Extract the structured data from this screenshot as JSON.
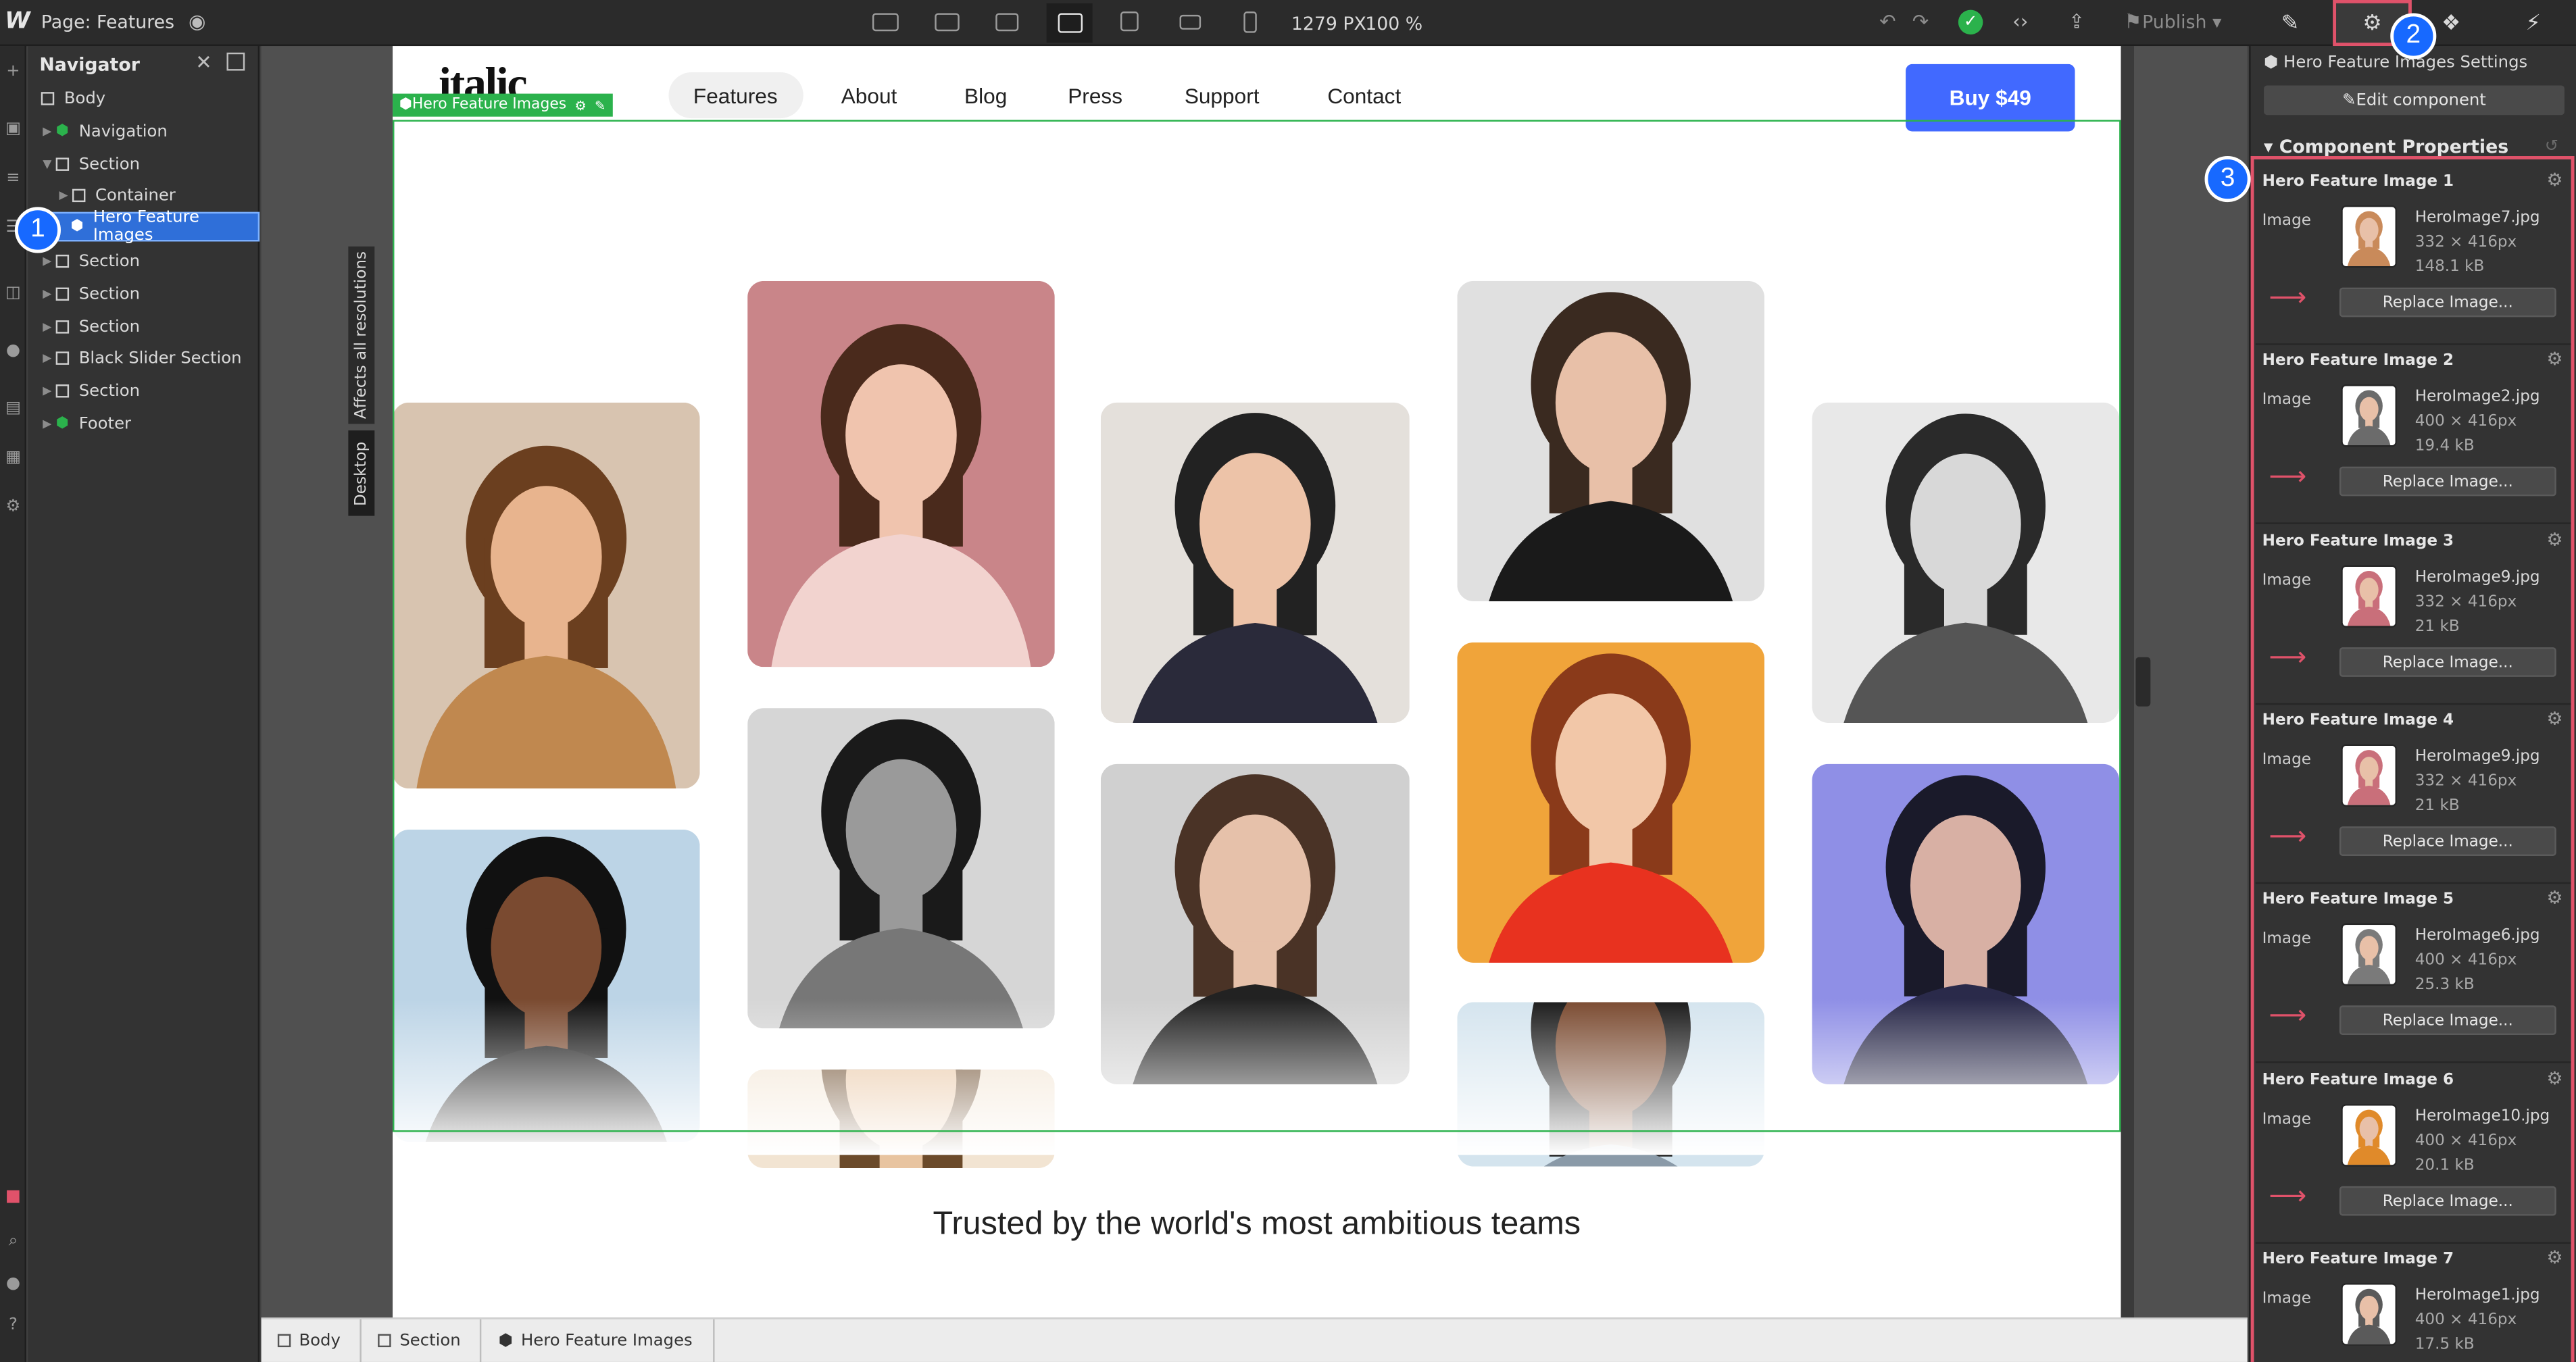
{
  "topbar": {
    "page_label": "Page: Features",
    "viewport_width": "1279 PX",
    "zoom": "100 %",
    "publish_label": "Publish"
  },
  "navigator": {
    "title": "Navigator",
    "items": [
      {
        "label": "Body"
      },
      {
        "label": "Navigation"
      },
      {
        "label": "Section"
      },
      {
        "label": "Container"
      },
      {
        "label": "Hero Feature Images"
      },
      {
        "label": "Section"
      },
      {
        "label": "Section"
      },
      {
        "label": "Section"
      },
      {
        "label": "Black Slider Section"
      },
      {
        "label": "Section"
      },
      {
        "label": "Footer"
      }
    ]
  },
  "canvas": {
    "affects_label": "Affects all resolutions",
    "breakpoint_label": "Desktop",
    "site": {
      "brand": "italic",
      "nav_links": [
        "Features",
        "About",
        "Blog",
        "Press",
        "Support",
        "Contact"
      ],
      "buy_label": "Buy $49",
      "selected_tag": "Hero Feature Images",
      "trusted_text": "Trusted by the world's most ambitious teams"
    }
  },
  "breadcrumbs": [
    "Body",
    "Section",
    "Hero Feature Images"
  ],
  "panel": {
    "settings_title": "Hero Feature Images Settings",
    "edit_component_label": "Edit component",
    "properties_title": "Component Properties",
    "props": [
      {
        "title": "Hero Feature Image 1",
        "label": "Image",
        "file": "HeroImage7.jpg",
        "dims": "332 × 416px",
        "size": "148.1 kB",
        "replace": "Replace Image...",
        "tone": "#c98a5a"
      },
      {
        "title": "Hero Feature Image 2",
        "label": "Image",
        "file": "HeroImage2.jpg",
        "dims": "400 × 416px",
        "size": "19.4 kB",
        "replace": "Replace Image...",
        "tone": "#6b6b6b"
      },
      {
        "title": "Hero Feature Image 3",
        "label": "Image",
        "file": "HeroImage9.jpg",
        "dims": "332 × 416px",
        "size": "21 kB",
        "replace": "Replace Image...",
        "tone": "#c96f7a"
      },
      {
        "title": "Hero Feature Image 4",
        "label": "Image",
        "file": "HeroImage9.jpg",
        "dims": "332 × 416px",
        "size": "21 kB",
        "replace": "Replace Image...",
        "tone": "#c96f7a"
      },
      {
        "title": "Hero Feature Image 5",
        "label": "Image",
        "file": "HeroImage6.jpg",
        "dims": "400 × 416px",
        "size": "25.3 kB",
        "replace": "Replace Image...",
        "tone": "#7a7a7a"
      },
      {
        "title": "Hero Feature Image 6",
        "label": "Image",
        "file": "HeroImage10.jpg",
        "dims": "400 × 416px",
        "size": "20.1 kB",
        "replace": "Replace Image...",
        "tone": "#e08a2a"
      },
      {
        "title": "Hero Feature Image 7",
        "label": "Image",
        "file": "HeroImage1.jpg",
        "dims": "400 × 416px",
        "size": "17.5 kB",
        "replace": "Replace Image...",
        "tone": "#5a5a5a"
      }
    ]
  },
  "callouts": [
    "1",
    "2",
    "3"
  ],
  "hero_tiles": [
    {
      "bg": "#d8c4b0",
      "hair": "#6b3f1f",
      "skin": "#e8b48e",
      "cloth": "#c0884f"
    },
    {
      "bg": "#c98589",
      "hair": "#4a2a1c",
      "skin": "#f0c4ae",
      "cloth": "#f2d3cf"
    },
    {
      "bg": "#e4e0db",
      "hair": "#222222",
      "skin": "#edc3a8",
      "cloth": "#2a2a3a"
    },
    {
      "bg": "#e0e0e0",
      "hair": "#3a2a20",
      "skin": "#e8c0a8",
      "cloth": "#1a1a1a"
    },
    {
      "bg": "#e8e8e8",
      "hair": "#2a2a2a",
      "skin": "#d8d8d8",
      "cloth": "#555555"
    },
    {
      "bg": "#bcd4e6",
      "hair": "#111111",
      "skin": "#7a4a30",
      "cloth": "#1a1a1a"
    },
    {
      "bg": "#d6d6d6",
      "hair": "#1a1a1a",
      "skin": "#9a9a9a",
      "cloth": "#777777"
    },
    {
      "bg": "#d0d0d0",
      "hair": "#4a3326",
      "skin": "#e6c1aa",
      "cloth": "#222222"
    },
    {
      "bg": "#f0a43a",
      "hair": "#8a3a1a",
      "skin": "#f2c7a8",
      "cloth": "#e8321f"
    },
    {
      "bg": "#8f8fe6",
      "hair": "#1a1a2a",
      "skin": "#d8b0a4",
      "cloth": "#2a2a4a"
    },
    {
      "bg": "#f2e4d2",
      "hair": "#6b4a2a",
      "skin": "#e8c4a0",
      "cloth": "#d8c0a0"
    },
    {
      "bg": "#d4e4ee",
      "hair": "#1a1a1a",
      "skin": "#7a4a30",
      "cloth": "#8a9aa8"
    }
  ]
}
